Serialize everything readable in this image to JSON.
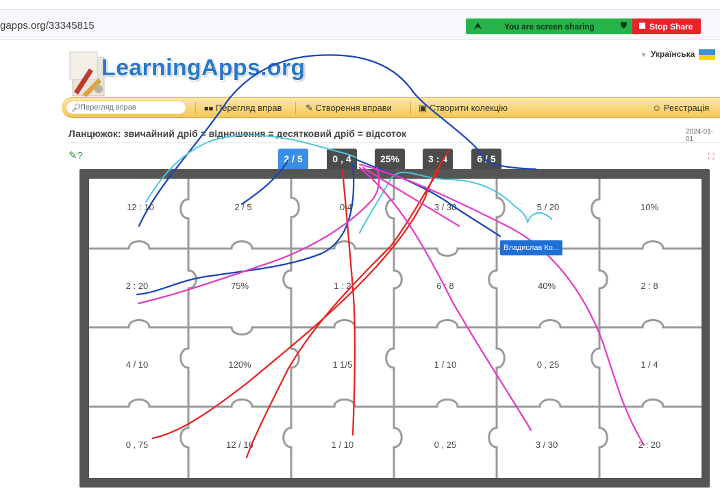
{
  "browser": {
    "url": "gapps.org/33345815"
  },
  "sharing": {
    "text": "You are screen sharing",
    "stop_label": "Stop Share",
    "colors": {
      "banner": "#27b34a",
      "stop": "#e8242a"
    }
  },
  "language": "Українська",
  "logo": "LearningApps.org",
  "nav": {
    "search_placeholder": "Перегляд вправ",
    "items": [
      "Перегляд вправ",
      "Створення вправи",
      "Створити колекцію"
    ],
    "register": "Реєстрація"
  },
  "page": {
    "title": "Ланцюжок: звичайний дріб = відношення = десятковий дріб = відсоток",
    "date": "2024-01-01"
  },
  "tabs": [
    {
      "label": "2 / 5",
      "active": true
    },
    {
      "label": "0 , 4",
      "active": false
    },
    {
      "label": "25%",
      "active": false
    },
    {
      "label": "3 : 4",
      "active": false
    },
    {
      "label": "6 / 5",
      "active": false
    }
  ],
  "grid": [
    [
      "12 : 10",
      "2 / 5",
      "0,4",
      "3 / 30",
      "5 / 20",
      "10%"
    ],
    [
      "2 : 20",
      "75%",
      "1 : 2",
      "6 : 8",
      "40%",
      "2 : 8"
    ],
    [
      "4 / 10",
      "120%",
      "1 1/5",
      "1 / 10",
      "0 , 25",
      "1 / 4"
    ],
    [
      "0 , 75",
      "12 / 16",
      "1 / 10",
      "0 , 25",
      "3 / 30",
      "2 : 20"
    ]
  ],
  "annotator": "Владислав Ко...",
  "colors": {
    "accent": "#3a8ee6",
    "board": "#555555",
    "nav": "#f4c85a",
    "ink_blue": "#1a47b8",
    "ink_cyan": "#49c6e0",
    "ink_red": "#e8231f",
    "ink_magenta": "#e43cc4"
  }
}
